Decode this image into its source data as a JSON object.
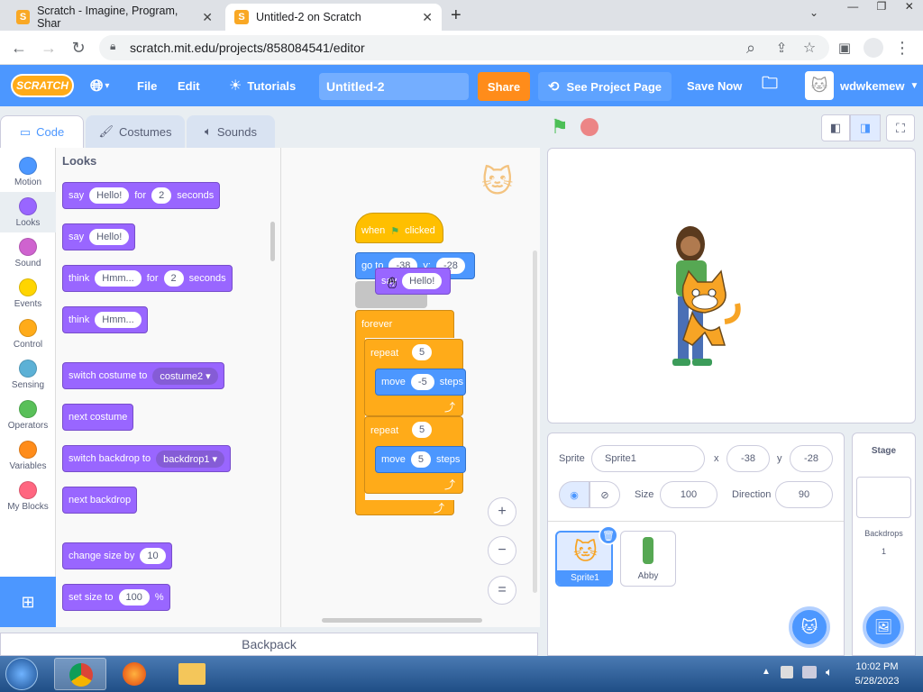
{
  "browser": {
    "tabs": [
      {
        "title": "Scratch - Imagine, Program, Shar",
        "active": false
      },
      {
        "title": "Untitled-2 on Scratch",
        "active": true
      }
    ],
    "url": "scratch.mit.edu/projects/858084541/editor"
  },
  "menubar": {
    "logo": "SCRATCH",
    "file": "File",
    "edit": "Edit",
    "tutorials": "Tutorials",
    "project_title": "Untitled-2",
    "share": "Share",
    "see_project": "See Project Page",
    "save_now": "Save Now",
    "username": "wdwkemew"
  },
  "editor_tabs": {
    "code": "Code",
    "costumes": "Costumes",
    "sounds": "Sounds"
  },
  "categories": [
    {
      "label": "Motion",
      "color": "#4c97ff"
    },
    {
      "label": "Looks",
      "color": "#9966ff"
    },
    {
      "label": "Sound",
      "color": "#cf63cf"
    },
    {
      "label": "Events",
      "color": "#ffd500"
    },
    {
      "label": "Control",
      "color": "#ffab19"
    },
    {
      "label": "Sensing",
      "color": "#5cb1d6"
    },
    {
      "label": "Operators",
      "color": "#59c059"
    },
    {
      "label": "Variables",
      "color": "#ff8c1a"
    },
    {
      "label": "My Blocks",
      "color": "#ff6680"
    }
  ],
  "palette": {
    "heading": "Looks",
    "b1": {
      "a": "say",
      "v1": "Hello!",
      "b": "for",
      "v2": "2",
      "c": "seconds"
    },
    "b2": {
      "a": "say",
      "v1": "Hello!"
    },
    "b3": {
      "a": "think",
      "v1": "Hmm...",
      "b": "for",
      "v2": "2",
      "c": "seconds"
    },
    "b4": {
      "a": "think",
      "v1": "Hmm..."
    },
    "b5": {
      "a": "switch costume to",
      "v1": "costume2"
    },
    "b6": {
      "a": "next costume"
    },
    "b7": {
      "a": "switch backdrop to",
      "v1": "backdrop1"
    },
    "b8": {
      "a": "next backdrop"
    },
    "b9": {
      "a": "change size by",
      "v1": "10"
    },
    "b10": {
      "a": "set size to",
      "v1": "100",
      "b": "%"
    }
  },
  "script": {
    "hat": {
      "a": "when",
      "b": "clicked"
    },
    "goto": {
      "a": "go to",
      "v1": "-38",
      "b": "y:",
      "v2": "-28"
    },
    "drag_say": {
      "a": "say",
      "v1": "Hello!"
    },
    "forever": "forever",
    "repeat1": {
      "a": "repeat",
      "v": "5"
    },
    "move1": {
      "a": "move",
      "v": "-5",
      "b": "steps"
    },
    "repeat2": {
      "a": "repeat",
      "v": "5"
    },
    "move2": {
      "a": "move",
      "v": "5",
      "b": "steps"
    },
    "zoom_in": "+",
    "zoom_out": "−",
    "zoom_reset": "="
  },
  "sprite_info": {
    "sprite_label": "Sprite",
    "sprite_name": "Sprite1",
    "x_label": "x",
    "x": "-38",
    "y_label": "y",
    "y": "-28",
    "size_label": "Size",
    "size": "100",
    "direction_label": "Direction",
    "direction": "90"
  },
  "sprites": [
    {
      "name": "Sprite1",
      "selected": true
    },
    {
      "name": "Abby",
      "selected": false
    }
  ],
  "stage_panel": {
    "title": "Stage",
    "backdrops_label": "Backdrops",
    "backdrops_count": "1"
  },
  "backpack": "Backpack",
  "taskbar": {
    "time": "10:02 PM",
    "date": "5/28/2023"
  }
}
